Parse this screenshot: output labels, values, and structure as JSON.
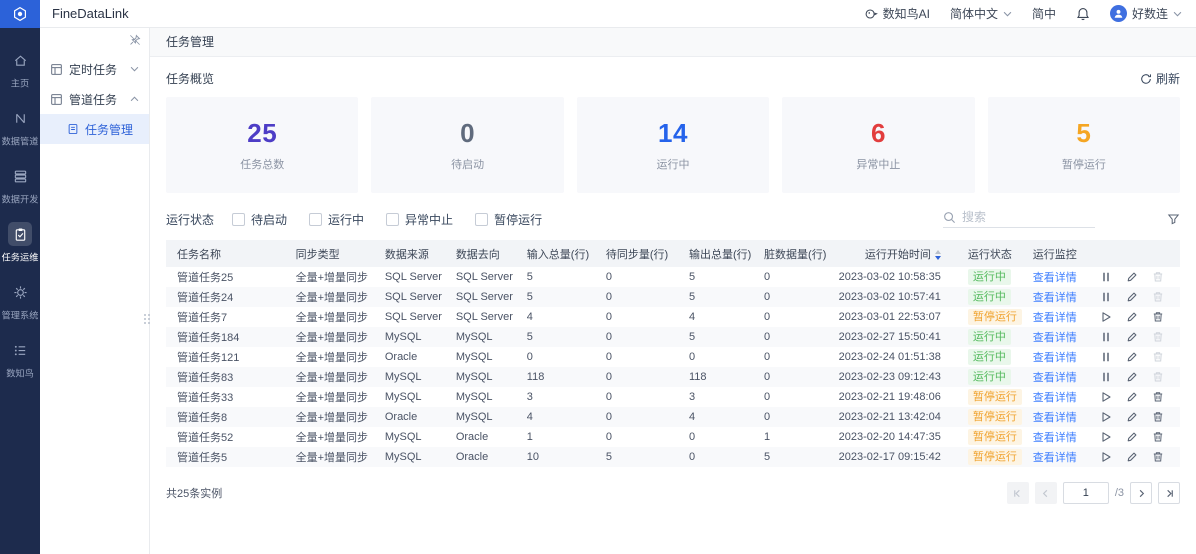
{
  "topbar": {
    "brand": "FineDataLink",
    "ai_assistant": "数知鸟AI",
    "language": "简体中文",
    "language_short": "简中",
    "username": "好数连"
  },
  "primary_nav": [
    {
      "label": "主页",
      "icon": "home-icon",
      "active": false
    },
    {
      "label": "数据管道",
      "icon": "data-pipeline-icon",
      "active": false
    },
    {
      "label": "数据开发",
      "icon": "data-develop-icon",
      "active": false
    },
    {
      "label": "任务运维",
      "icon": "task-ops-icon",
      "active": true
    },
    {
      "label": "管理系统",
      "icon": "system-settings-icon",
      "active": false
    },
    {
      "label": "数知鸟",
      "icon": "shuzhiniao-icon",
      "active": false
    }
  ],
  "secondary_nav": [
    {
      "label": "定时任务",
      "type": "group",
      "expanded": false
    },
    {
      "label": "管道任务",
      "type": "group",
      "expanded": true
    },
    {
      "label": "任务管理",
      "type": "child",
      "selected": true
    }
  ],
  "page": {
    "title": "任务管理",
    "overview_title": "任务概览",
    "refresh_label": "刷新"
  },
  "stats": [
    {
      "value": "25",
      "label": "任务总数",
      "color": "#4d3dc6"
    },
    {
      "value": "0",
      "label": "待启动",
      "color": "#606b7d"
    },
    {
      "value": "14",
      "label": "运行中",
      "color": "#2563eb"
    },
    {
      "value": "6",
      "label": "异常中止",
      "color": "#e23d3d"
    },
    {
      "value": "5",
      "label": "暂停运行",
      "color": "#f5a623"
    }
  ],
  "filter": {
    "label": "运行状态",
    "options": [
      "待启动",
      "运行中",
      "异常中止",
      "暂停运行"
    ],
    "search_placeholder": "搜索"
  },
  "table": {
    "columns": [
      "任务名称",
      "同步类型",
      "数据来源",
      "数据去向",
      "输入总量(行)",
      "待同步量(行)",
      "输出总量(行)",
      "脏数据量(行)",
      "运行开始时间",
      "运行状态",
      "运行监控"
    ],
    "sort_column_index": 8,
    "monitor_link_label": "查看详情",
    "rows": [
      {
        "cells": [
          "管道任务25",
          "全量+增量同步",
          "SQL Server",
          "SQL Server",
          "5",
          "0",
          "5",
          "0",
          "2023-03-02 10:58:35"
        ],
        "status": "运行中",
        "status_type": "running",
        "actions": {
          "toggle_icon": "pause-icon",
          "edit_icon": "edit-icon",
          "delete_icon": "delete-icon",
          "delete_enabled": false
        }
      },
      {
        "cells": [
          "管道任务24",
          "全量+增量同步",
          "SQL Server",
          "SQL Server",
          "5",
          "0",
          "5",
          "0",
          "2023-03-02 10:57:41"
        ],
        "status": "运行中",
        "status_type": "running",
        "actions": {
          "toggle_icon": "pause-icon",
          "edit_icon": "edit-icon",
          "delete_icon": "delete-icon",
          "delete_enabled": false
        }
      },
      {
        "cells": [
          "管道任务7",
          "全量+增量同步",
          "SQL Server",
          "SQL Server",
          "4",
          "0",
          "4",
          "0",
          "2023-03-01 22:53:07"
        ],
        "status": "暂停运行",
        "status_type": "paused",
        "actions": {
          "toggle_icon": "play-icon",
          "edit_icon": "edit-icon",
          "delete_icon": "delete-icon",
          "delete_enabled": true
        }
      },
      {
        "cells": [
          "管道任务184",
          "全量+增量同步",
          "MySQL",
          "MySQL",
          "5",
          "0",
          "5",
          "0",
          "2023-02-27 15:50:41"
        ],
        "status": "运行中",
        "status_type": "running",
        "actions": {
          "toggle_icon": "pause-icon",
          "edit_icon": "edit-icon",
          "delete_icon": "delete-icon",
          "delete_enabled": false
        }
      },
      {
        "cells": [
          "管道任务121",
          "全量+增量同步",
          "Oracle",
          "MySQL",
          "0",
          "0",
          "0",
          "0",
          "2023-02-24 01:51:38"
        ],
        "status": "运行中",
        "status_type": "running",
        "actions": {
          "toggle_icon": "pause-icon",
          "edit_icon": "edit-icon",
          "delete_icon": "delete-icon",
          "delete_enabled": false
        }
      },
      {
        "cells": [
          "管道任务83",
          "全量+增量同步",
          "MySQL",
          "MySQL",
          "118",
          "0",
          "118",
          "0",
          "2023-02-23 09:12:43"
        ],
        "status": "运行中",
        "status_type": "running",
        "actions": {
          "toggle_icon": "pause-icon",
          "edit_icon": "edit-icon",
          "delete_icon": "delete-icon",
          "delete_enabled": false
        }
      },
      {
        "cells": [
          "管道任务33",
          "全量+增量同步",
          "MySQL",
          "MySQL",
          "3",
          "0",
          "3",
          "0",
          "2023-02-21 19:48:06"
        ],
        "status": "暂停运行",
        "status_type": "paused",
        "actions": {
          "toggle_icon": "play-icon",
          "edit_icon": "edit-icon",
          "delete_icon": "delete-icon",
          "delete_enabled": true
        }
      },
      {
        "cells": [
          "管道任务8",
          "全量+增量同步",
          "Oracle",
          "MySQL",
          "4",
          "0",
          "4",
          "0",
          "2023-02-21 13:42:04"
        ],
        "status": "暂停运行",
        "status_type": "paused",
        "actions": {
          "toggle_icon": "play-icon",
          "edit_icon": "edit-icon",
          "delete_icon": "delete-icon",
          "delete_enabled": true
        }
      },
      {
        "cells": [
          "管道任务52",
          "全量+增量同步",
          "MySQL",
          "Oracle",
          "1",
          "0",
          "0",
          "1",
          "2023-02-20 14:47:35"
        ],
        "status": "暂停运行",
        "status_type": "paused",
        "actions": {
          "toggle_icon": "play-icon",
          "edit_icon": "edit-icon",
          "delete_icon": "delete-icon",
          "delete_enabled": true
        }
      },
      {
        "cells": [
          "管道任务5",
          "全量+增量同步",
          "MySQL",
          "Oracle",
          "10",
          "5",
          "0",
          "5",
          "2023-02-17 09:15:42"
        ],
        "status": "暂停运行",
        "status_type": "paused",
        "actions": {
          "toggle_icon": "play-icon",
          "edit_icon": "edit-icon",
          "delete_icon": "delete-icon",
          "delete_enabled": true
        }
      }
    ],
    "footer": {
      "total_label": "共25条实例",
      "current_page": "1",
      "total_pages_label": "/3"
    }
  }
}
